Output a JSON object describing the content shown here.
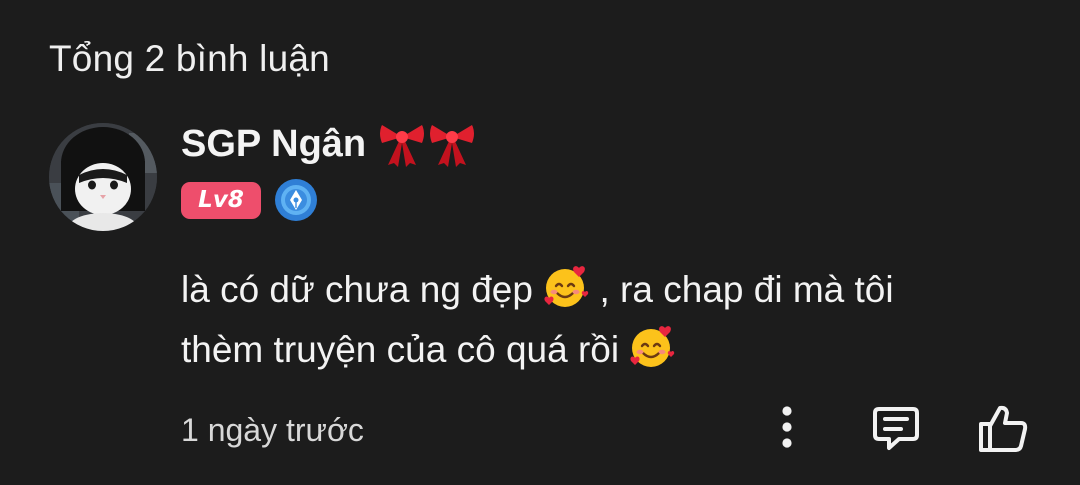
{
  "header": {
    "title": "Tổng 2 bình luận"
  },
  "comment": {
    "author": "SGP Ngân",
    "author_decoration_icon": "ribbon-bow-icon",
    "level_badge": "Lv8",
    "level_badge_color": "#ee4e6c",
    "writer_badge_icon": "pen-nib-badge-icon",
    "text_line_1_part_1": "là có dữ chưa ng đẹp",
    "text_line_1_part_2": ", ra chap đi mà tôi",
    "text_line_2": "thèm truyện của cô quá rồi",
    "emoji_icon": "smiling-face-with-hearts-icon",
    "timestamp": "1 ngày trước",
    "actions": {
      "more_icon": "more-vertical-icon",
      "reply_icon": "comment-icon",
      "like_icon": "thumbs-up-icon"
    }
  },
  "colors": {
    "background": "#1c1c1c",
    "text": "#f2f2f2",
    "level_badge": "#ee4e6c",
    "writer_badge": "#2f7fd6"
  }
}
